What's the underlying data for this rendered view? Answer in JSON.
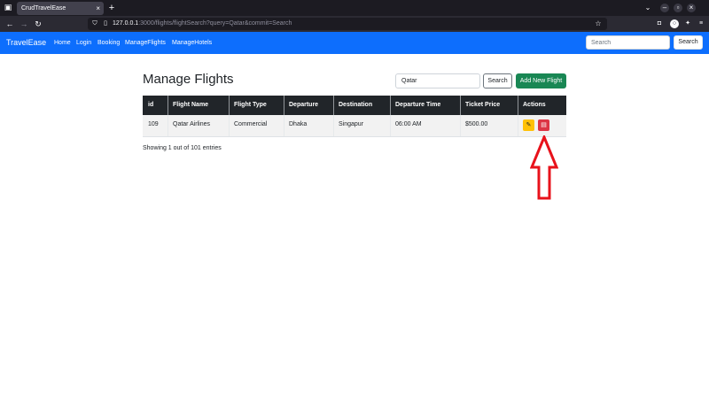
{
  "browser": {
    "tab_title": "CrudTravelEase",
    "tab_close": "×",
    "new_tab": "+",
    "url_host": "127.0.0.1",
    "url_path": ":3000/flights/flightSearch?query=Qatar&commit=Search"
  },
  "navbar": {
    "brand": "TravelEase",
    "links": [
      "Home",
      "Login",
      "Booking",
      "ManageFlights",
      "ManageHotels"
    ],
    "search_placeholder": "Search",
    "search_button": "Search",
    "color": "#0d6efd"
  },
  "main": {
    "title": "Manage Flights",
    "query_value": "Qatar",
    "search_button": "Search",
    "add_button": "Add New Flight",
    "add_button_color": "#198754"
  },
  "table": {
    "headers": [
      "id",
      "Flight Name",
      "Flight Type",
      "Departure",
      "Destination",
      "Departure Time",
      "Ticket Price",
      "Actions"
    ],
    "rows": [
      {
        "id": "109",
        "flight_name": "Qatar Airlines",
        "flight_type": "Commercial",
        "departure": "Dhaka",
        "destination": "Singapur",
        "departure_time": "06:00 AM",
        "ticket_price": "$500.00"
      }
    ],
    "edit_color": "#ffc107",
    "delete_color": "#dc3545"
  },
  "footer": {
    "entries_text": "Showing 1 out of 101 entries"
  },
  "annotation": {
    "arrow_color": "#e8121b",
    "icon": "up-arrow-icon"
  }
}
